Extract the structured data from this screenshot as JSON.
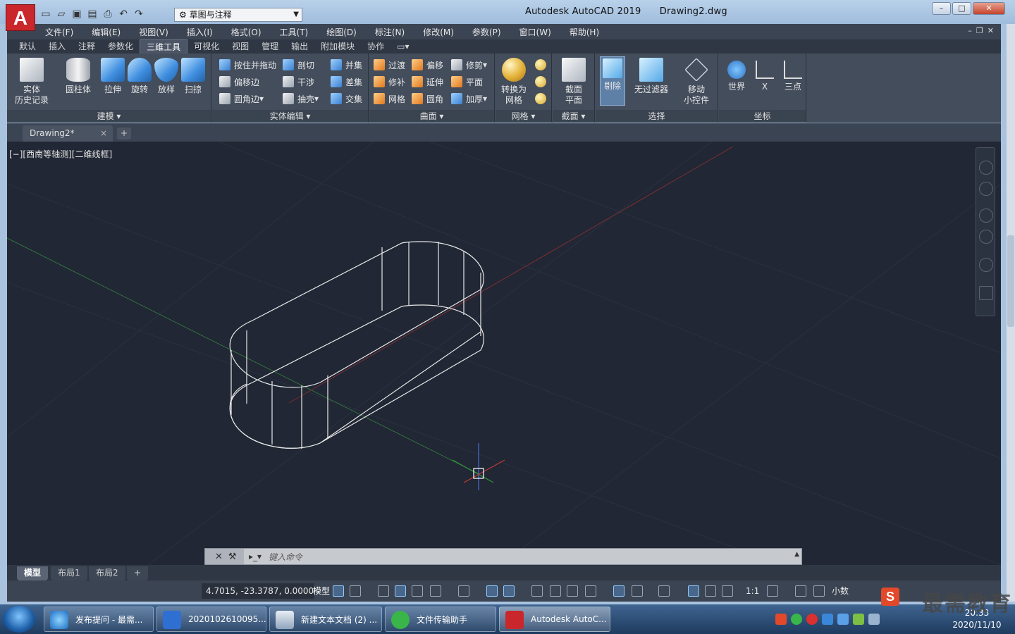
{
  "app": {
    "logo_letter": "A",
    "title": "Autodesk AutoCAD 2019",
    "document": "Drawing2.dwg",
    "workspace": "草图与注释"
  },
  "menu": [
    "文件(F)",
    "编辑(E)",
    "视图(V)",
    "插入(I)",
    "格式(O)",
    "工具(T)",
    "绘图(D)",
    "标注(N)",
    "修改(M)",
    "参数(P)",
    "窗口(W)",
    "帮助(H)"
  ],
  "ribbon_tabs": [
    "默认",
    "插入",
    "注释",
    "参数化",
    "三维工具",
    "可视化",
    "视图",
    "管理",
    "输出",
    "附加模块",
    "协作"
  ],
  "ribbon_tab_active": "三维工具",
  "ribbon": {
    "modeling": {
      "title": "建模",
      "history": "实体\n历史记录",
      "cylinder": "圆柱体",
      "extrude": "拉伸",
      "revolve": "旋转",
      "loft": "放样",
      "sweep": "扫掠"
    },
    "solid_edit": {
      "title": "实体编辑",
      "presspull": "按住并拖动",
      "offset_edge": "偏移边",
      "fillet_edge": "圆角边",
      "slice": "剖切",
      "interfere": "干涉",
      "shell": "抽壳",
      "union": "并集",
      "subtract": "差集",
      "intersect": "交集"
    },
    "surface": {
      "title": "曲面",
      "blend": "过渡",
      "patch": "修补",
      "network": "网格",
      "offset": "偏移",
      "extend": "延伸",
      "fillet": "圆角",
      "trim": "修剪",
      "planar": "平面",
      "thicken": "加厚"
    },
    "mesh": {
      "title": "网格",
      "convert": "转换为\n网格"
    },
    "section": {
      "title": "截面",
      "section_plane": "截面\n平面"
    },
    "selection": {
      "title": "选择",
      "cull": "剔除",
      "no_filter": "无过滤器",
      "gizmo": "移动\n小控件"
    },
    "coordinates": {
      "title": "坐标",
      "world": "世界",
      "x": "X",
      "three_point": "三点"
    }
  },
  "doc_tab": {
    "label": "Drawing2*",
    "close": "×",
    "add": "+"
  },
  "viewport": {
    "label": "[−][西南等轴测][二维线框]"
  },
  "command": {
    "placeholder": "键入命令"
  },
  "layout_tabs": [
    "模型",
    "布局1",
    "布局2",
    "+"
  ],
  "status": {
    "coords": "4.7015, -23.3787, 0.0000",
    "model": "模型",
    "scale": "1:1",
    "units": "小数"
  },
  "taskbar": {
    "items": [
      {
        "label": "发布提问 - 最需..."
      },
      {
        "label": "2020102610095..."
      },
      {
        "label": "新建文本文档 (2) ..."
      },
      {
        "label": "文件传输助手"
      },
      {
        "label": "Autodesk AutoC..."
      }
    ],
    "time": "20:33",
    "date": "2020/11/10"
  },
  "watermark": "最需教育",
  "colors": {
    "viewport_bg": "#212734",
    "ribbon_bg": "#434d5c",
    "accent_red": "#c9272b",
    "wire": "#e8e8e8"
  }
}
